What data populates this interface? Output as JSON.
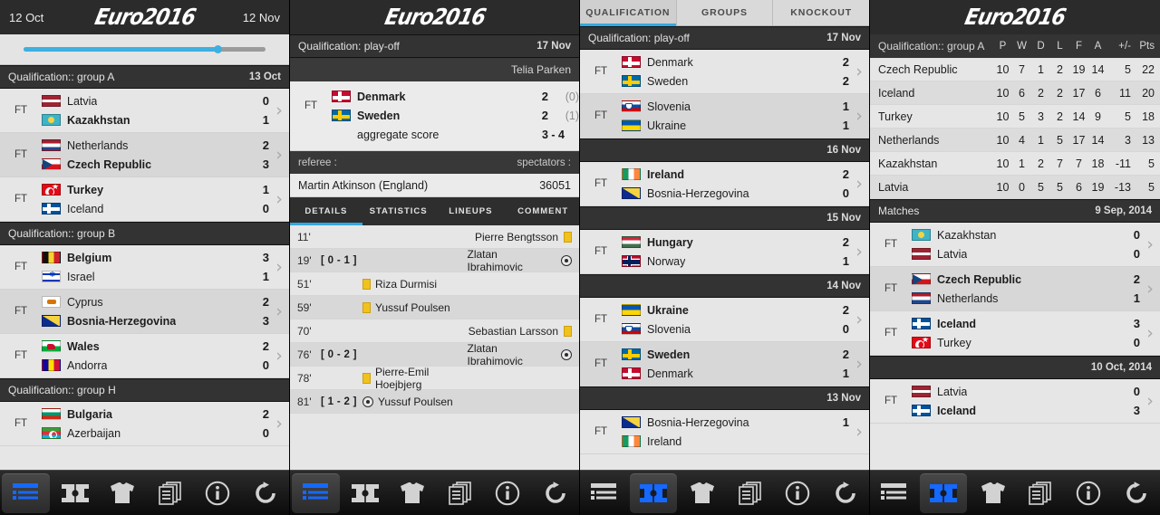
{
  "app": {
    "logo_text": "Euro2016"
  },
  "panel1": {
    "topbar": {
      "left_date": "12 Oct",
      "right_date": "12 Nov"
    },
    "seek": {
      "progress_percent": 80
    },
    "sections": [
      {
        "title": "Qualification:: group A",
        "date": "13 Oct",
        "matches": [
          {
            "status": "FT",
            "home": "Latvia",
            "away": "Kazakhstan",
            "home_score": "0",
            "away_score": "1",
            "winner": "away",
            "home_flag": "f-lv",
            "away_flag": "f-kz"
          },
          {
            "status": "FT",
            "home": "Netherlands",
            "away": "Czech Republic",
            "home_score": "2",
            "away_score": "3",
            "winner": "away",
            "home_flag": "f-nl",
            "away_flag": "f-cz"
          },
          {
            "status": "FT",
            "home": "Turkey",
            "away": "Iceland",
            "home_score": "1",
            "away_score": "0",
            "winner": "home",
            "home_flag": "f-tr",
            "away_flag": "f-is"
          }
        ]
      },
      {
        "title": "Qualification:: group B",
        "date": "",
        "matches": [
          {
            "status": "FT",
            "home": "Belgium",
            "away": "Israel",
            "home_score": "3",
            "away_score": "1",
            "winner": "home",
            "home_flag": "f-be",
            "away_flag": "f-il"
          },
          {
            "status": "FT",
            "home": "Cyprus",
            "away": "Bosnia-Herzegovina",
            "home_score": "2",
            "away_score": "3",
            "winner": "away",
            "home_flag": "f-cy",
            "away_flag": "f-ba"
          },
          {
            "status": "FT",
            "home": "Wales",
            "away": "Andorra",
            "home_score": "2",
            "away_score": "0",
            "winner": "home",
            "home_flag": "f-wa",
            "away_flag": "f-ad"
          }
        ]
      },
      {
        "title": "Qualification:: group H",
        "date": "",
        "matches": [
          {
            "status": "FT",
            "home": "Bulgaria",
            "away": "Azerbaijan",
            "home_score": "2",
            "away_score": "0",
            "winner": "home",
            "home_flag": "f-bg",
            "away_flag": "f-az"
          }
        ]
      }
    ]
  },
  "panel2": {
    "header": {
      "competition": "Qualification: play-off",
      "date": "17 Nov",
      "stadium": "Telia Parken"
    },
    "match": {
      "status": "FT",
      "home": "Denmark",
      "away": "Sweden",
      "home_score": "2",
      "away_score": "2",
      "home_half": "(0)",
      "away_half": "(1)",
      "home_flag": "f-dk",
      "away_flag": "f-se",
      "aggregate_label": "aggregate score",
      "aggregate_value": "3 - 4"
    },
    "meta": {
      "referee_label": "referee :",
      "spectators_label": "spectators :",
      "referee_value": "Martin Atkinson (England)",
      "spectators_value": "36051"
    },
    "tabs": [
      {
        "label": "DETAILS",
        "active": true
      },
      {
        "label": "STATISTICS",
        "active": false
      },
      {
        "label": "LINEUPS",
        "active": false
      },
      {
        "label": "COMMENT",
        "active": false
      }
    ],
    "events": [
      {
        "minute": "11'",
        "result": "",
        "side": "away",
        "player": "Pierre Bengtsson",
        "icon": "yellow-card"
      },
      {
        "minute": "19'",
        "result": "[ 0 - 1 ]",
        "side": "away",
        "player": "Zlatan Ibrahimovic",
        "icon": "goal"
      },
      {
        "minute": "51'",
        "result": "",
        "side": "home",
        "player": "Riza Durmisi",
        "icon": "yellow-card"
      },
      {
        "minute": "59'",
        "result": "",
        "side": "home",
        "player": "Yussuf Poulsen",
        "icon": "yellow-card"
      },
      {
        "minute": "70'",
        "result": "",
        "side": "away",
        "player": "Sebastian Larsson",
        "icon": "yellow-card"
      },
      {
        "minute": "76'",
        "result": "[ 0 - 2 ]",
        "side": "away",
        "player": "Zlatan Ibrahimovic",
        "icon": "goal"
      },
      {
        "minute": "78'",
        "result": "",
        "side": "home",
        "player": "Pierre-Emil Hoejbjerg",
        "icon": "yellow-card"
      },
      {
        "minute": "81'",
        "result": "[ 1 - 2 ]",
        "side": "home",
        "player": "Yussuf Poulsen",
        "icon": "goal"
      }
    ]
  },
  "panel3": {
    "tabs": [
      {
        "label": "QUALIFICATION",
        "active": true
      },
      {
        "label": "GROUPS",
        "active": false
      },
      {
        "label": "KNOCKOUT",
        "active": false
      }
    ],
    "sections": [
      {
        "title": "Qualification: play-off",
        "date": "17 Nov",
        "matches": [
          {
            "status": "FT",
            "home": "Denmark",
            "away": "Sweden",
            "home_score": "2",
            "away_score": "2",
            "winner": "none",
            "home_flag": "f-dk",
            "away_flag": "f-se"
          },
          {
            "status": "FT",
            "home": "Slovenia",
            "away": "Ukraine",
            "home_score": "1",
            "away_score": "1",
            "winner": "none",
            "home_flag": "f-si",
            "away_flag": "f-ua"
          }
        ]
      },
      {
        "title": "",
        "date": "16 Nov",
        "matches": [
          {
            "status": "FT",
            "home": "Ireland",
            "away": "Bosnia-Herzegovina",
            "home_score": "2",
            "away_score": "0",
            "winner": "home",
            "home_flag": "f-ie",
            "away_flag": "f-ba"
          }
        ]
      },
      {
        "title": "",
        "date": "15 Nov",
        "matches": [
          {
            "status": "FT",
            "home": "Hungary",
            "away": "Norway",
            "home_score": "2",
            "away_score": "1",
            "winner": "home",
            "home_flag": "f-hu",
            "away_flag": "f-no"
          }
        ]
      },
      {
        "title": "",
        "date": "14 Nov",
        "matches": [
          {
            "status": "FT",
            "home": "Ukraine",
            "away": "Slovenia",
            "home_score": "2",
            "away_score": "0",
            "winner": "home",
            "home_flag": "f-ua",
            "away_flag": "f-si"
          },
          {
            "status": "FT",
            "home": "Sweden",
            "away": "Denmark",
            "home_score": "2",
            "away_score": "1",
            "winner": "home",
            "home_flag": "f-se",
            "away_flag": "f-dk"
          }
        ]
      },
      {
        "title": "",
        "date": "13 Nov",
        "matches": [
          {
            "status": "FT",
            "home": "Bosnia-Herzegovina",
            "away": "Ireland",
            "home_score": "1",
            "away_score": "",
            "winner": "none",
            "home_flag": "f-ba",
            "away_flag": "f-ie"
          }
        ]
      }
    ]
  },
  "panel4": {
    "table": {
      "group_label": "Qualification:: group A",
      "columns": [
        "P",
        "W",
        "D",
        "L",
        "F",
        "A",
        "+/-",
        "Pts"
      ],
      "rows": [
        {
          "team": "Czech Republic",
          "P": "10",
          "W": "7",
          "D": "1",
          "L": "2",
          "F": "19",
          "A": "14",
          "GD": "5",
          "Pts": "22"
        },
        {
          "team": "Iceland",
          "P": "10",
          "W": "6",
          "D": "2",
          "L": "2",
          "F": "17",
          "A": "6",
          "GD": "11",
          "Pts": "20"
        },
        {
          "team": "Turkey",
          "P": "10",
          "W": "5",
          "D": "3",
          "L": "2",
          "F": "14",
          "A": "9",
          "GD": "5",
          "Pts": "18"
        },
        {
          "team": "Netherlands",
          "P": "10",
          "W": "4",
          "D": "1",
          "L": "5",
          "F": "17",
          "A": "14",
          "GD": "3",
          "Pts": "13"
        },
        {
          "team": "Kazakhstan",
          "P": "10",
          "W": "1",
          "D": "2",
          "L": "7",
          "F": "7",
          "A": "18",
          "GD": "-11",
          "Pts": "5"
        },
        {
          "team": "Latvia",
          "P": "10",
          "W": "0",
          "D": "5",
          "L": "5",
          "F": "6",
          "A": "19",
          "GD": "-13",
          "Pts": "5"
        }
      ]
    },
    "sections": [
      {
        "title": "Matches",
        "date": "9 Sep, 2014",
        "matches": [
          {
            "status": "FT",
            "home": "Kazakhstan",
            "away": "Latvia",
            "home_score": "0",
            "away_score": "0",
            "winner": "none",
            "home_flag": "f-kz",
            "away_flag": "f-lv"
          },
          {
            "status": "FT",
            "home": "Czech Republic",
            "away": "Netherlands",
            "home_score": "2",
            "away_score": "1",
            "winner": "home",
            "home_flag": "f-cz",
            "away_flag": "f-nl"
          },
          {
            "status": "FT",
            "home": "Iceland",
            "away": "Turkey",
            "home_score": "3",
            "away_score": "0",
            "winner": "home",
            "home_flag": "f-is",
            "away_flag": "f-tr"
          }
        ]
      },
      {
        "title": "",
        "date": "10 Oct, 2014",
        "matches": [
          {
            "status": "FT",
            "home": "Latvia",
            "away": "Iceland",
            "home_score": "0",
            "away_score": "3",
            "winner": "away",
            "home_flag": "f-lv",
            "away_flag": "f-is"
          }
        ]
      }
    ]
  },
  "toolbar": {
    "items": [
      {
        "name": "list-icon",
        "label": "List"
      },
      {
        "name": "pitch-icon",
        "label": "Pitch"
      },
      {
        "name": "shirt-icon",
        "label": "Squad"
      },
      {
        "name": "documents-icon",
        "label": "News"
      },
      {
        "name": "info-icon",
        "label": "Info"
      },
      {
        "name": "refresh-icon",
        "label": "Refresh"
      }
    ],
    "selected": {
      "panel1": 0,
      "panel2": 0,
      "panel3": 1,
      "panel4": 1
    },
    "accent_color": "#1569ff"
  },
  "colors": {
    "accent": "#31a8e0",
    "dark_header": "#333333",
    "row_light": "#e6e6e6",
    "row_alt": "#d7d7d7",
    "yellow_card": "#f2c21c"
  }
}
